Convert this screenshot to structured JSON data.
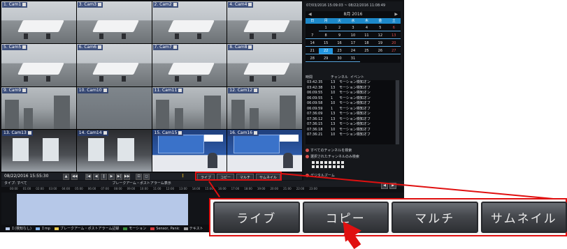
{
  "cameras": [
    {
      "label": "1. Cam1",
      "scene": "room"
    },
    {
      "label": "3. Cam3",
      "scene": "room"
    },
    {
      "label": "2. Cam2",
      "scene": "room"
    },
    {
      "label": "4. Cam4",
      "scene": "room"
    },
    {
      "label": "5. Cam5",
      "scene": "room"
    },
    {
      "label": "6. Cam6",
      "scene": "room"
    },
    {
      "label": "7. Cam7",
      "scene": "room"
    },
    {
      "label": "8. Cam8",
      "scene": "room"
    },
    {
      "label": "9. Cam9",
      "scene": "city"
    },
    {
      "label": "10. Cam10",
      "scene": "rain"
    },
    {
      "label": "11. Cam11",
      "scene": "city"
    },
    {
      "label": "12. Cam12",
      "scene": "city"
    },
    {
      "label": "13. Cam13",
      "scene": "office"
    },
    {
      "label": "14. Cam14",
      "scene": "office"
    },
    {
      "label": "15. Cam15",
      "scene": "tv"
    },
    {
      "label": "16. Cam16",
      "scene": "tv"
    }
  ],
  "sidebar": {
    "date_range": "07/03/2016 15:09:03 ~ 08/22/2016 11:08:49",
    "calendar": {
      "month_title": "8月 2016",
      "weekdays": [
        "日",
        "月",
        "火",
        "水",
        "木",
        "金",
        "土"
      ],
      "weeks": [
        [
          "",
          "1",
          "2",
          "3",
          "4",
          "5",
          "6"
        ],
        [
          "7",
          "8",
          "9",
          "10",
          "11",
          "12",
          "13"
        ],
        [
          "14",
          "15",
          "16",
          "17",
          "18",
          "19",
          "20"
        ],
        [
          "21",
          "22",
          "23",
          "24",
          "25",
          "26",
          "27"
        ],
        [
          "28",
          "29",
          "30",
          "31",
          "",
          "",
          ""
        ]
      ],
      "selected_day": "22"
    },
    "event_header": {
      "time": "時間",
      "channel": "チャンネル",
      "event": "イベント"
    },
    "events": [
      {
        "time": "03:42:35",
        "ch": "13",
        "type": "モーション検知オン"
      },
      {
        "time": "03:42:38",
        "ch": "13",
        "type": "モーション検知オフ"
      },
      {
        "time": "06:09:55",
        "ch": "10",
        "type": "モーション検知オン"
      },
      {
        "time": "06:09:55",
        "ch": "1",
        "type": "モーション検知オン"
      },
      {
        "time": "06:09:58",
        "ch": "10",
        "type": "モーション検知オフ"
      },
      {
        "time": "06:09:59",
        "ch": "1",
        "type": "モーション検知オフ"
      },
      {
        "time": "07:36:09",
        "ch": "13",
        "type": "モーション検知オン"
      },
      {
        "time": "07:36:12",
        "ch": "13",
        "type": "モーション検知オフ"
      },
      {
        "time": "07:36:15",
        "ch": "13",
        "type": "モーション検知オン"
      },
      {
        "time": "07:36:18",
        "ch": "10",
        "type": "モーション検知オフ"
      },
      {
        "time": "07:36:21",
        "ch": "10",
        "type": "モーション検知オフ"
      }
    ],
    "options": {
      "all_channels": "すべてのチャンネルを検索",
      "selected_channels": "選択されたチャンネルのみ検索",
      "digital_zoom": "デジタルズーム"
    }
  },
  "playback": {
    "timestamp": "08/22/2016 15:55:30",
    "mode_buttons": [
      "ライブ",
      "コピー",
      "マルチ",
      "サムネイル"
    ]
  },
  "timeline": {
    "filter_label": "タイプ: すべて",
    "filter_extra": "ブレークアーム・ポストアラーム表示",
    "hours": [
      "00:00",
      "01:00",
      "02:00",
      "03:00",
      "04:00",
      "05:00",
      "06:00",
      "07:00",
      "08:00",
      "09:00",
      "10:00",
      "11:00",
      "12:00",
      "13:00",
      "14:00",
      "15:00",
      "16:00",
      "17:00",
      "18:00",
      "19:00",
      "20:00",
      "21:00",
      "22:00",
      "23:00"
    ],
    "legend": [
      {
        "label": "Ｉ(検知なし)",
        "color": "#b6c8e8"
      },
      {
        "label": "Ｉmp",
        "color": "#7fb0e8"
      },
      {
        "label": "ブレークアーム・ポストアラーム記録",
        "color": "#e8c84a"
      },
      {
        "label": "モーション",
        "color": "#3a8a3a"
      },
      {
        "label": "Sensor, Panic",
        "color": "#d43a3a"
      },
      {
        "label": "テキスト",
        "color": "#a0a0a0"
      }
    ]
  },
  "callout": {
    "buttons": [
      "ライブ",
      "コピー",
      "マルチ",
      "サムネイル"
    ]
  },
  "colors": {
    "highlight": "#e01010",
    "accent": "#1d88c9"
  }
}
